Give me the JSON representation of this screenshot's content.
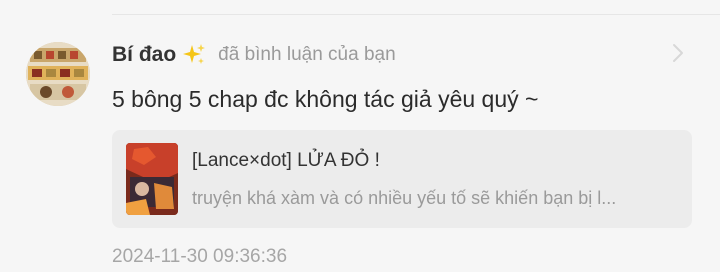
{
  "notification": {
    "username": "Bí đao",
    "username_emoji_icon": "sparkles-icon",
    "action_text": "đã bình luận của bạn",
    "comment_text": "5 bông 5 chap đc không tác giả yêu quý ~",
    "referenced_comment": {
      "title": "[Lance×dot] LỬA ĐỎ !",
      "snippet": "truyện khá xàm và có nhiều yếu tố sẽ khiến bạn bị l..."
    },
    "timestamp": "2024-11-30 09:36:36"
  },
  "colors": {
    "background": "#f6f6f6",
    "card_background": "#ececec",
    "username": "#333333",
    "secondary_text": "#9a9a9a",
    "sparkle": "#f5c518"
  },
  "icons": {
    "header_right": "chevron-right-icon"
  }
}
